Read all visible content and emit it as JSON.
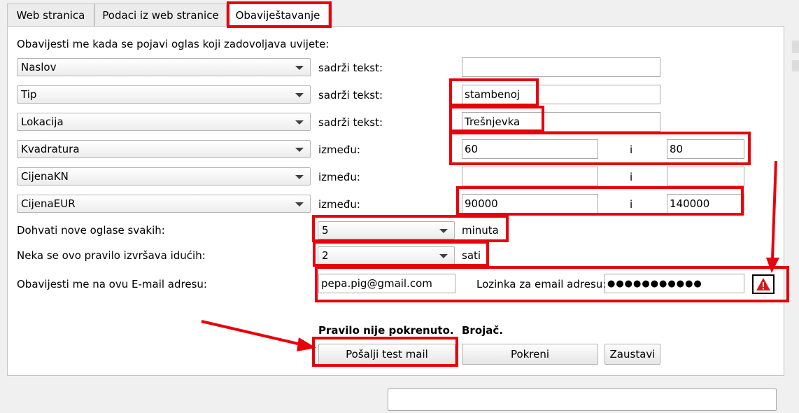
{
  "tabs": [
    {
      "label": "Web stranica"
    },
    {
      "label": "Podaci iz web stranice"
    },
    {
      "label": "Obaviještavanje"
    }
  ],
  "form": {
    "heading": "Obavijesti me kada se pojavi oglas koji zadovoljava uvijete:",
    "rows": [
      {
        "field": "Naslov",
        "condition": "sadrži tekst:",
        "value": ""
      },
      {
        "field": "Tip",
        "condition": "sadrži tekst:",
        "value": "stambenoj"
      },
      {
        "field": "Lokacija",
        "condition": "sadrži tekst:",
        "value": "Trešnjevka"
      },
      {
        "field": "Kvadratura",
        "condition": "između:",
        "from": "60",
        "and": "i",
        "to": "80"
      },
      {
        "field": "CijenaKN",
        "condition": "između:",
        "from": "",
        "and": "i",
        "to": ""
      },
      {
        "field": "CijenaEUR",
        "condition": "između:",
        "from": "90000",
        "and": "i",
        "to": "140000"
      }
    ],
    "interval": {
      "label": "Dohvati nove oglase svakih:",
      "value": "5",
      "unit": "minuta"
    },
    "duration": {
      "label": "Neka se ovo pravilo izvršava idućih:",
      "value": "2",
      "unit": "sati"
    },
    "email": {
      "label": "Obavijesti me na ovu E-mail adresu:",
      "value": "pepa.pig@gmail.com",
      "password_label": "Lozinka za email adresu:",
      "password_value": "●●●●●●●●●●●",
      "warning_icon": "warning-triangle-icon"
    }
  },
  "status": {
    "rule": "Pravilo nije pokrenuto.",
    "counter": "Brojač."
  },
  "buttons": {
    "test_mail": "Pošalji test mail",
    "start": "Pokreni",
    "stop": "Zaustavi"
  },
  "statusbar": {
    "value": ""
  },
  "annotation": {
    "color": "#e8000b"
  }
}
